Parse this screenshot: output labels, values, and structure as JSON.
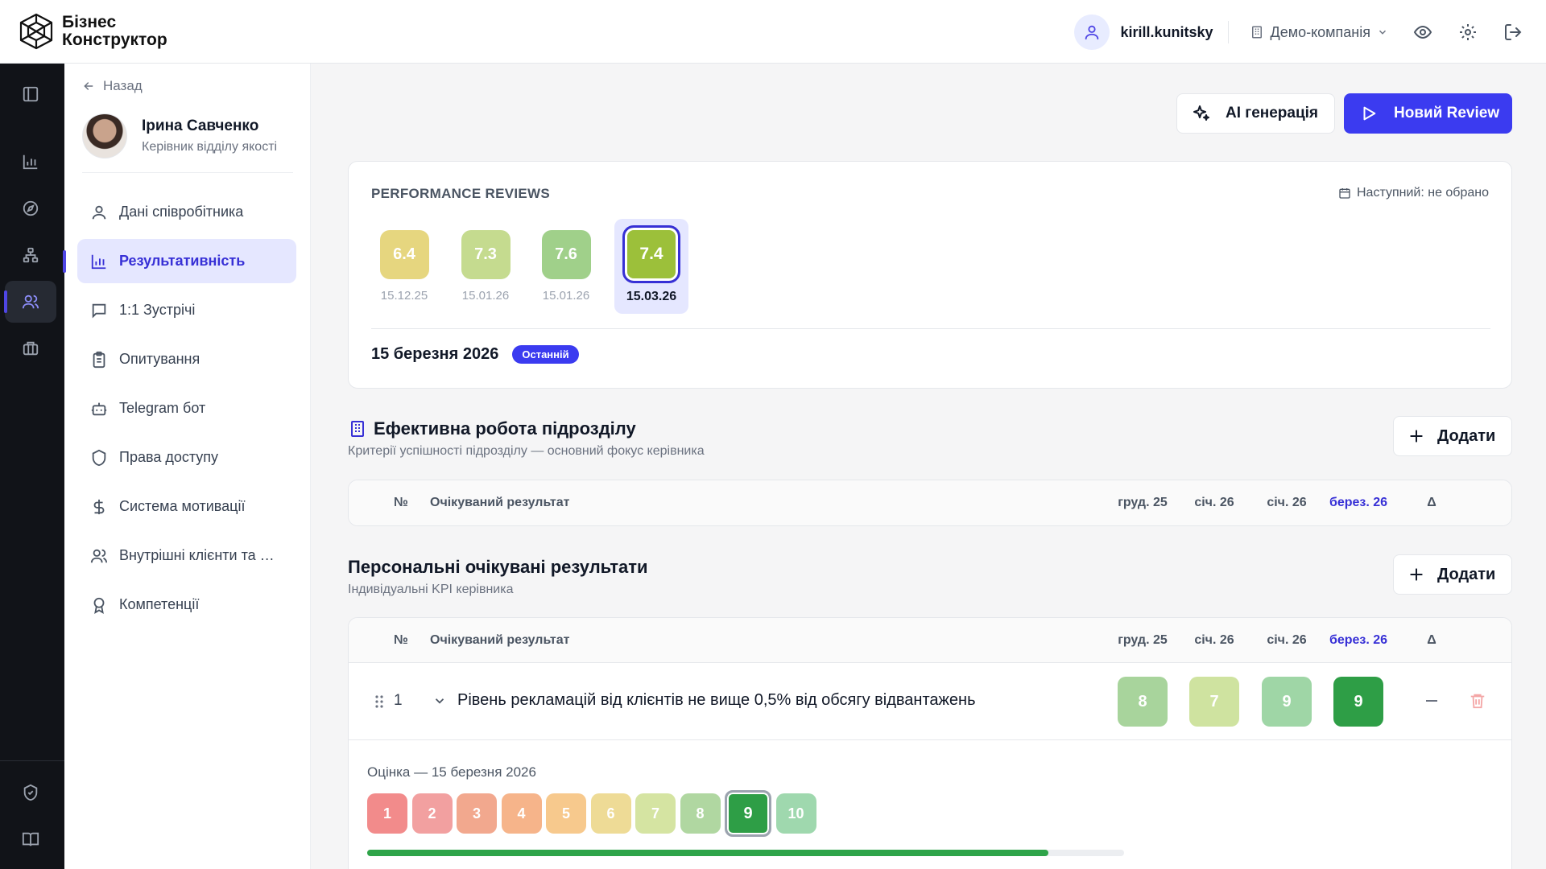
{
  "brand": {
    "line1": "Бізнес",
    "line2": "Конструктор"
  },
  "header": {
    "username": "kirill.kunitsky",
    "company": "Демо-компанія"
  },
  "sidebar": {
    "back_label": "Назад",
    "profile": {
      "name": "Ірина Савченко",
      "role": "Керівник відділу якості"
    },
    "items": [
      {
        "label": "Дані співробітника",
        "icon": "user-icon"
      },
      {
        "label": "Результативність",
        "icon": "bar-chart-icon",
        "active": true
      },
      {
        "label": "1:1 Зустрічі",
        "icon": "message-icon"
      },
      {
        "label": "Опитування",
        "icon": "clipboard-icon"
      },
      {
        "label": "Telegram бот",
        "icon": "bot-icon"
      },
      {
        "label": "Права доступу",
        "icon": "shield-icon"
      },
      {
        "label": "Система мотивації",
        "icon": "dollar-icon"
      },
      {
        "label": "Внутрішні клієнти та партнери",
        "icon": "users-icon"
      },
      {
        "label": "Компетенції",
        "icon": "award-icon"
      }
    ]
  },
  "toolbar": {
    "ai_label": "AI генерація",
    "new_review_label": "Новий Review"
  },
  "performance": {
    "title": "PERFORMANCE REVIEWS",
    "next_label": "Наступний: не обрано",
    "reviews": [
      {
        "score": "6.4",
        "date": "15.12.25",
        "color": "#e6d67f"
      },
      {
        "score": "7.3",
        "date": "15.01.26",
        "color": "#c5db8f"
      },
      {
        "score": "7.6",
        "date": "15.01.26",
        "color": "#a0d08a"
      },
      {
        "score": "7.4",
        "date": "15.03.26",
        "color": "#9cc03a",
        "selected": true
      }
    ],
    "current_date": "15 березня 2026",
    "current_badge": "Останній"
  },
  "unit_section": {
    "title": "Ефективна робота підрозділу",
    "subtitle": "Критерії успішності підрозділу — основний фокус керівника",
    "add_label": "Додати"
  },
  "personal_section": {
    "title": "Персональні очікувані результати",
    "subtitle": "Індивідуальні KPI керівника",
    "add_label": "Додати"
  },
  "table_headers": {
    "num": "№",
    "expected": "Очікуваний результат",
    "periods": [
      "груд. 25",
      "січ. 26",
      "січ. 26",
      "берез. 26"
    ],
    "delta": "Δ"
  },
  "kpi_rows": [
    {
      "index": "1",
      "text": "Рівень рекламацій від клієнтів не вище 0,5% від обсягу відвантажень",
      "scores": [
        {
          "value": "8",
          "color": "#a8d49c"
        },
        {
          "value": "7",
          "color": "#cfe3a0"
        },
        {
          "value": "9",
          "color": "#9fd6a6"
        },
        {
          "value": "9",
          "color": "#2e9e46"
        }
      ]
    }
  ],
  "evaluation": {
    "label": "Оцінка — 15 березня 2026",
    "scale": [
      {
        "value": "1",
        "color": "#f28b8b"
      },
      {
        "value": "2",
        "color": "#f2a0a0"
      },
      {
        "value": "3",
        "color": "#f2a88e"
      },
      {
        "value": "4",
        "color": "#f6b48a"
      },
      {
        "value": "5",
        "color": "#f7c98d"
      },
      {
        "value": "6",
        "color": "#eedb96"
      },
      {
        "value": "7",
        "color": "#d5e4a2"
      },
      {
        "value": "8",
        "color": "#b0d7a1"
      },
      {
        "value": "9",
        "color": "#2e9e46",
        "selected": true
      },
      {
        "value": "10",
        "color": "#9fd8ae"
      }
    ],
    "progress": 0.9
  }
}
